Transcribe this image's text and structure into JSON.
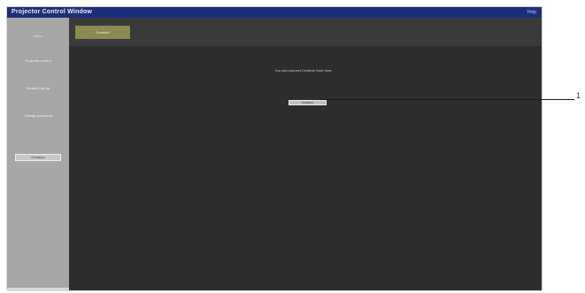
{
  "window": {
    "title": "Projector Control Window",
    "help_label": "Help"
  },
  "sidebar": {
    "items": [
      {
        "label": "Status",
        "active": true
      },
      {
        "label": "Projector control",
        "active": false
      },
      {
        "label": "Detailed set up",
        "active": false
      },
      {
        "label": "Change password",
        "active": false
      }
    ],
    "button_label": "Crestron"
  },
  "tabs": [
    {
      "label": "Crestron",
      "active": true
    }
  ],
  "main": {
    "message": "You can connect Crestron from here.",
    "button_label": "Crestron"
  },
  "callout": {
    "label": "1"
  },
  "colors": {
    "titlebar": "#1e2f7a",
    "sidebar": "#a7a7a7",
    "content": "#2d2d30",
    "active_tab": "#8a8a52"
  }
}
